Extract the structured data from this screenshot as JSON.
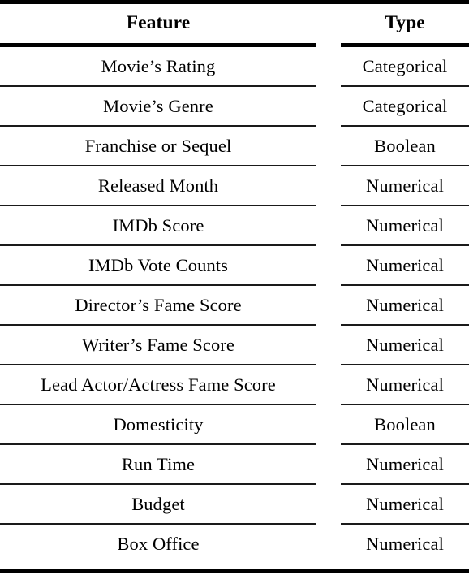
{
  "table": {
    "columns": [
      {
        "key": "feature",
        "header": "Feature",
        "align": "center"
      },
      {
        "key": "type",
        "header": "Type",
        "align": "center"
      }
    ],
    "rows": [
      {
        "feature": "Movie’s Rating",
        "type": "Categorical"
      },
      {
        "feature": "Movie’s Genre",
        "type": "Categorical"
      },
      {
        "feature": "Franchise or Sequel",
        "type": "Boolean"
      },
      {
        "feature": "Released Month",
        "type": "Numerical"
      },
      {
        "feature": "IMDb Score",
        "type": "Numerical"
      },
      {
        "feature": "IMDb Vote Counts",
        "type": "Numerical"
      },
      {
        "feature": "Director’s Fame Score",
        "type": "Numerical"
      },
      {
        "feature": "Writer’s Fame Score",
        "type": "Numerical"
      },
      {
        "feature": "Lead Actor/Actress Fame Score",
        "type": "Numerical"
      },
      {
        "feature": "Domesticity",
        "type": "Boolean"
      },
      {
        "feature": "Run Time",
        "type": "Numerical"
      },
      {
        "feature": "Budget",
        "type": "Numerical"
      },
      {
        "feature": "Box Office",
        "type": "Numerical"
      }
    ],
    "row_count": 13,
    "colors": {
      "text": "#000000",
      "rule": "#000000",
      "background": "#ffffff"
    }
  }
}
